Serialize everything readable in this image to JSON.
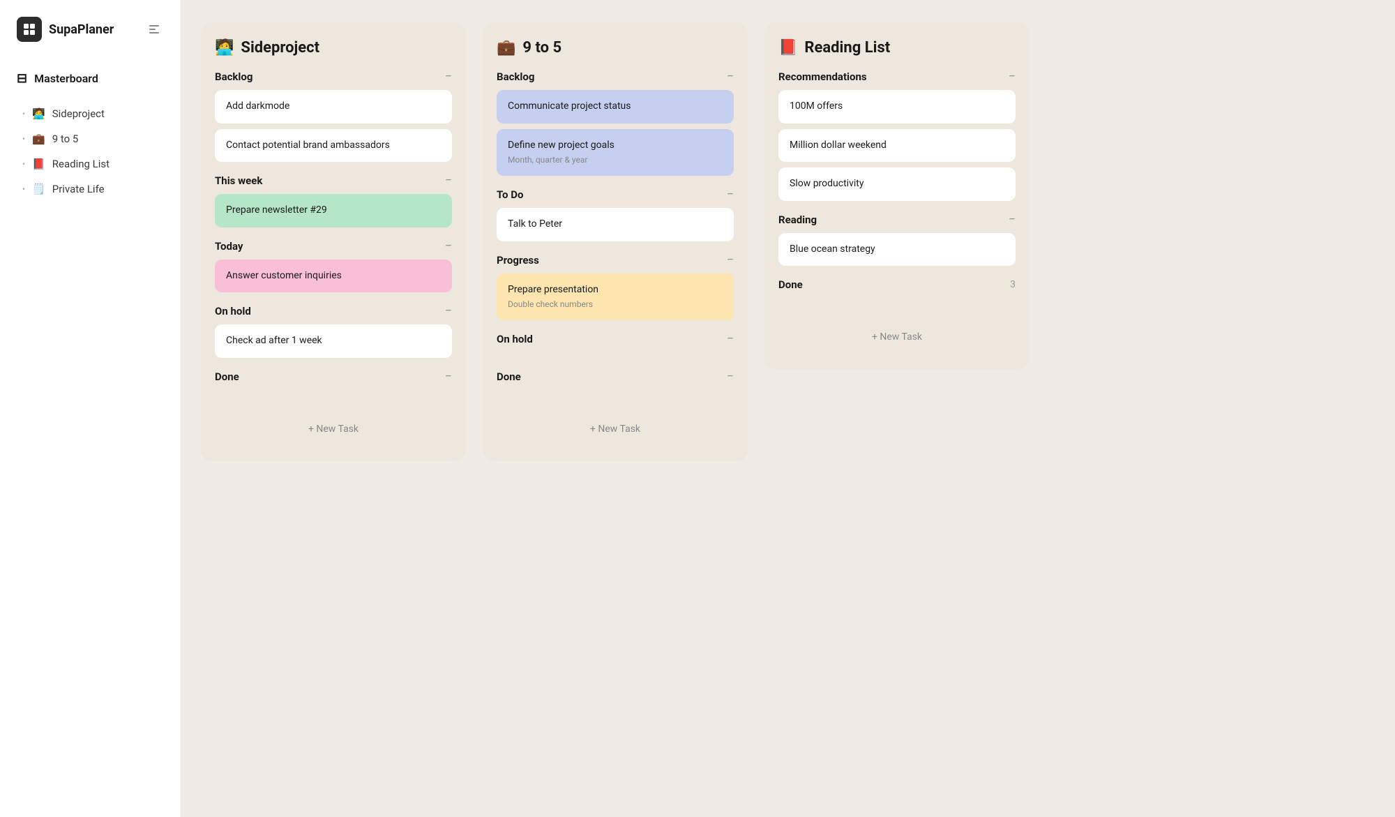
{
  "app": {
    "name": "SupaPlaner"
  },
  "sidebar": {
    "masterboard_label": "Masterboard",
    "nav_items": [
      {
        "id": "sideproject",
        "emoji": "🧑‍💻",
        "label": "Sideproject"
      },
      {
        "id": "9to5",
        "emoji": "💼",
        "label": "9 to 5"
      },
      {
        "id": "readinglist",
        "emoji": "📕",
        "label": "Reading List"
      },
      {
        "id": "privatelife",
        "emoji": "🗒️",
        "label": "Private Life"
      }
    ]
  },
  "columns": [
    {
      "id": "sideproject",
      "emoji": "🧑‍💻",
      "title": "Sideproject",
      "sections": [
        {
          "id": "backlog",
          "title": "Backlog",
          "count": null,
          "tasks": [
            {
              "id": "t1",
              "text": "Add darkmode",
              "subtitle": null,
              "color": "white"
            },
            {
              "id": "t2",
              "text": "Contact potential brand ambassadors",
              "subtitle": null,
              "color": "white"
            }
          ]
        },
        {
          "id": "this-week",
          "title": "This week",
          "count": null,
          "tasks": [
            {
              "id": "t3",
              "text": "Prepare newsletter #29",
              "subtitle": null,
              "color": "green"
            }
          ]
        },
        {
          "id": "today",
          "title": "Today",
          "count": null,
          "tasks": [
            {
              "id": "t4",
              "text": "Answer customer inquiries",
              "subtitle": null,
              "color": "pink"
            }
          ]
        },
        {
          "id": "on-hold",
          "title": "On hold",
          "count": null,
          "tasks": [
            {
              "id": "t5",
              "text": "Check ad after 1 week",
              "subtitle": null,
              "color": "white"
            }
          ]
        },
        {
          "id": "done",
          "title": "Done",
          "count": null,
          "tasks": []
        }
      ],
      "new_task_label": "+ New Task"
    },
    {
      "id": "9to5",
      "emoji": "💼",
      "title": "9 to 5",
      "sections": [
        {
          "id": "backlog",
          "title": "Backlog",
          "count": null,
          "tasks": [
            {
              "id": "t6",
              "text": "Communicate project status",
              "subtitle": null,
              "color": "blue"
            },
            {
              "id": "t7",
              "text": "Define new project goals",
              "subtitle": "Month, quarter & year",
              "color": "blue"
            }
          ]
        },
        {
          "id": "todo",
          "title": "To Do",
          "count": null,
          "tasks": [
            {
              "id": "t8",
              "text": "Talk to Peter",
              "subtitle": null,
              "color": "white"
            }
          ]
        },
        {
          "id": "progress",
          "title": "Progress",
          "count": null,
          "tasks": [
            {
              "id": "t9",
              "text": "Prepare presentation",
              "subtitle": "Double check numbers",
              "color": "orange"
            }
          ]
        },
        {
          "id": "on-hold",
          "title": "On hold",
          "count": null,
          "tasks": []
        },
        {
          "id": "done",
          "title": "Done",
          "count": null,
          "tasks": []
        }
      ],
      "new_task_label": "+ New Task"
    },
    {
      "id": "readinglist",
      "emoji": "📕",
      "title": "Reading List",
      "sections": [
        {
          "id": "recommendations",
          "title": "Recommendations",
          "count": null,
          "tasks": [
            {
              "id": "t10",
              "text": "100M offers",
              "subtitle": null,
              "color": "white"
            },
            {
              "id": "t11",
              "text": "Million dollar weekend",
              "subtitle": null,
              "color": "white"
            },
            {
              "id": "t12",
              "text": "Slow productivity",
              "subtitle": null,
              "color": "white"
            }
          ]
        },
        {
          "id": "reading",
          "title": "Reading",
          "count": null,
          "tasks": [
            {
              "id": "t13",
              "text": "Blue ocean strategy",
              "subtitle": null,
              "color": "white"
            }
          ]
        },
        {
          "id": "done",
          "title": "Done",
          "count": "3",
          "tasks": []
        }
      ],
      "new_task_label": "+ New Task"
    }
  ]
}
